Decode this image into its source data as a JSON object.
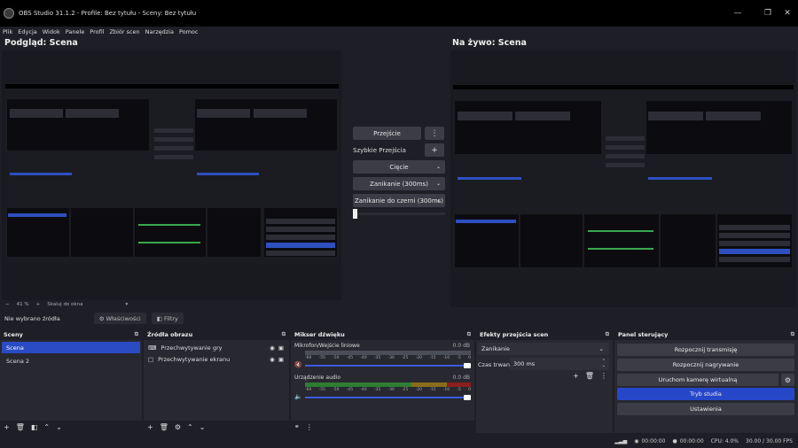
{
  "window": {
    "title": "OBS Studio 31.1.2 - Profile: Bez tytułu - Sceny: Bez tytułu"
  },
  "menu": [
    "Plik",
    "Edycja",
    "Widok",
    "Panele",
    "Profil",
    "Zbiór scen",
    "Narzędzia",
    "Pomoc"
  ],
  "preview": {
    "title": "Podgląd: Scena",
    "zoom": "41 %",
    "scale_label": "Skaluj do okna"
  },
  "program": {
    "title": "Na żywo: Scena"
  },
  "transition_panel": {
    "transition_btn": "Przejście",
    "quick_label": "Szybkie Przejścia",
    "options": [
      "Cięcie",
      "Zanikanie (300ms)",
      "Zanikanie do czerni (300ms)"
    ]
  },
  "source_bar": {
    "no_source": "Nie wybrano źródła",
    "properties": "Właściwości",
    "filters": "Filtry"
  },
  "scenes": {
    "title": "Sceny",
    "items": [
      "Scena",
      "Scena 2"
    ]
  },
  "sources": {
    "title": "Źródła obrazu",
    "items": [
      "Przechwytywanie gry",
      "Przechwytywanie ekranu"
    ]
  },
  "mixer": {
    "title": "Mikser dźwięku",
    "channels": [
      {
        "name": "Mikrofon/Wejście liniowe",
        "db": "0.0 dB"
      },
      {
        "name": "Urządzenie audio",
        "db": "0.0 dB"
      }
    ],
    "ticks": [
      "-60",
      "-55",
      "-50",
      "-45",
      "-40",
      "-35",
      "-30",
      "-25",
      "-20",
      "-15",
      "-10",
      "-5",
      "0"
    ]
  },
  "transitions_dock": {
    "title": "Efekty przejścia scen",
    "selected": "Zanikanie",
    "duration_label": "Czas trwania",
    "duration": "300 ms"
  },
  "controls": {
    "title": "Panel sterujący",
    "buttons": [
      "Rozpocznij transmisję",
      "Rozpocznij nagrywanie",
      "Uruchom kamerę wirtualną",
      "Tryb studia",
      "Ustawienia"
    ]
  },
  "status": {
    "stream_time": "00:00:00",
    "rec_time": "00:00:00",
    "cpu": "CPU: 4.0%",
    "fps": "30.00 / 30.00 FPS"
  },
  "colors": {
    "accent": "#2747c9",
    "bg": "#1e1f26",
    "panel": "#272830"
  }
}
